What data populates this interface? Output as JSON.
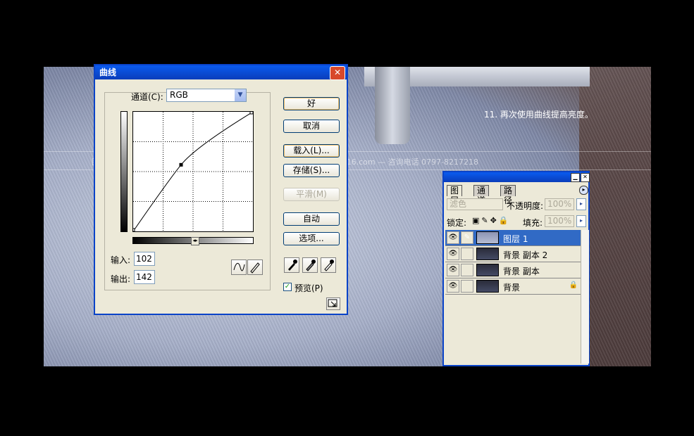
{
  "tutorial": {
    "caption": "11. 再次使用曲线提高亮度。",
    "watermark": "图片教程：思缘设计论坛 — 赣州思缘网络公司 — 网址 http://www.hq1516.com — 咨询电话 0797-8217218"
  },
  "curves_dialog": {
    "title": "曲线",
    "channel_label": "通道(C):",
    "channel_value": "RGB",
    "input_label": "输入:",
    "input_value": "102",
    "output_label": "输出:",
    "output_value": "142",
    "buttons": {
      "ok": "好",
      "cancel": "取消",
      "load": "载入(L)...",
      "save": "存储(S)...",
      "smooth": "平滑(M)",
      "auto": "自动",
      "options": "选项..."
    },
    "preview_label": "预览(P)",
    "preview_checked": true,
    "curve": {
      "point": [
        102,
        142
      ]
    }
  },
  "layers_panel": {
    "tabs": [
      "图层",
      "通道",
      "路径"
    ],
    "blend_mode": "滤色",
    "opacity_label": "不透明度:",
    "opacity_value": "100%",
    "lock_label": "锁定:",
    "fill_label": "填充:",
    "fill_value": "100%",
    "layers": [
      {
        "name": "图层 1",
        "selected": true
      },
      {
        "name": "背景 副本 2",
        "selected": false
      },
      {
        "name": "背景 副本",
        "selected": false
      },
      {
        "name": "背景",
        "selected": false,
        "locked": true
      }
    ]
  }
}
